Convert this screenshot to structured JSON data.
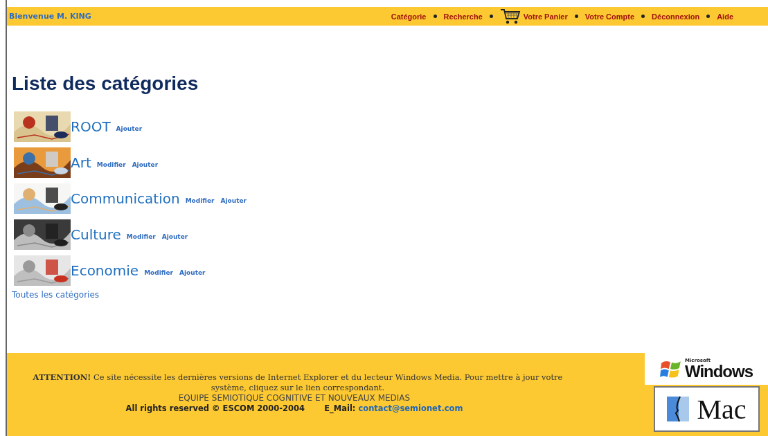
{
  "header": {
    "welcome": "Bienvenue M. KING",
    "nav": [
      {
        "label": "Catégorie",
        "kind": "link"
      },
      {
        "label": "Recherche",
        "kind": "link"
      },
      {
        "label": "Votre Panier",
        "kind": "cart"
      },
      {
        "label": "Votre Compte",
        "kind": "link"
      },
      {
        "label": "Déconnexion",
        "kind": "link"
      },
      {
        "label": "Aide",
        "kind": "link"
      }
    ]
  },
  "title": "Liste des catégories",
  "categories": [
    {
      "name": "ROOT",
      "actions": [
        "Ajouter"
      ]
    },
    {
      "name": "Art",
      "actions": [
        "Modifier",
        "Ajouter"
      ]
    },
    {
      "name": "Communication",
      "actions": [
        "Modifier",
        "Ajouter"
      ]
    },
    {
      "name": "Culture",
      "actions": [
        "Modifier",
        "Ajouter"
      ]
    },
    {
      "name": "Economie",
      "actions": [
        "Modifier",
        "Ajouter"
      ]
    }
  ],
  "all_link": "Toutes les catégories",
  "footer": {
    "notice": "**ATTENTION!** Ce site nécessite les dernières versions de Internet Explorer et du lecteur Windows Media. Pour mettre à jour votre système, cliquez sur le lien correspondant.",
    "team": "EQUIPE SEMIOTIQUE COGNITIVE ET NOUVEAUX MEDIAS",
    "rights": "All rights reserved © ESCOM 2000-2004",
    "email_label": "E_Mail:",
    "email": "contact@semionet.com"
  },
  "badges": [
    {
      "kind": "windows",
      "brand": "Microsoft",
      "name": "Windows"
    },
    {
      "kind": "mac",
      "name": "Mac"
    }
  ]
}
